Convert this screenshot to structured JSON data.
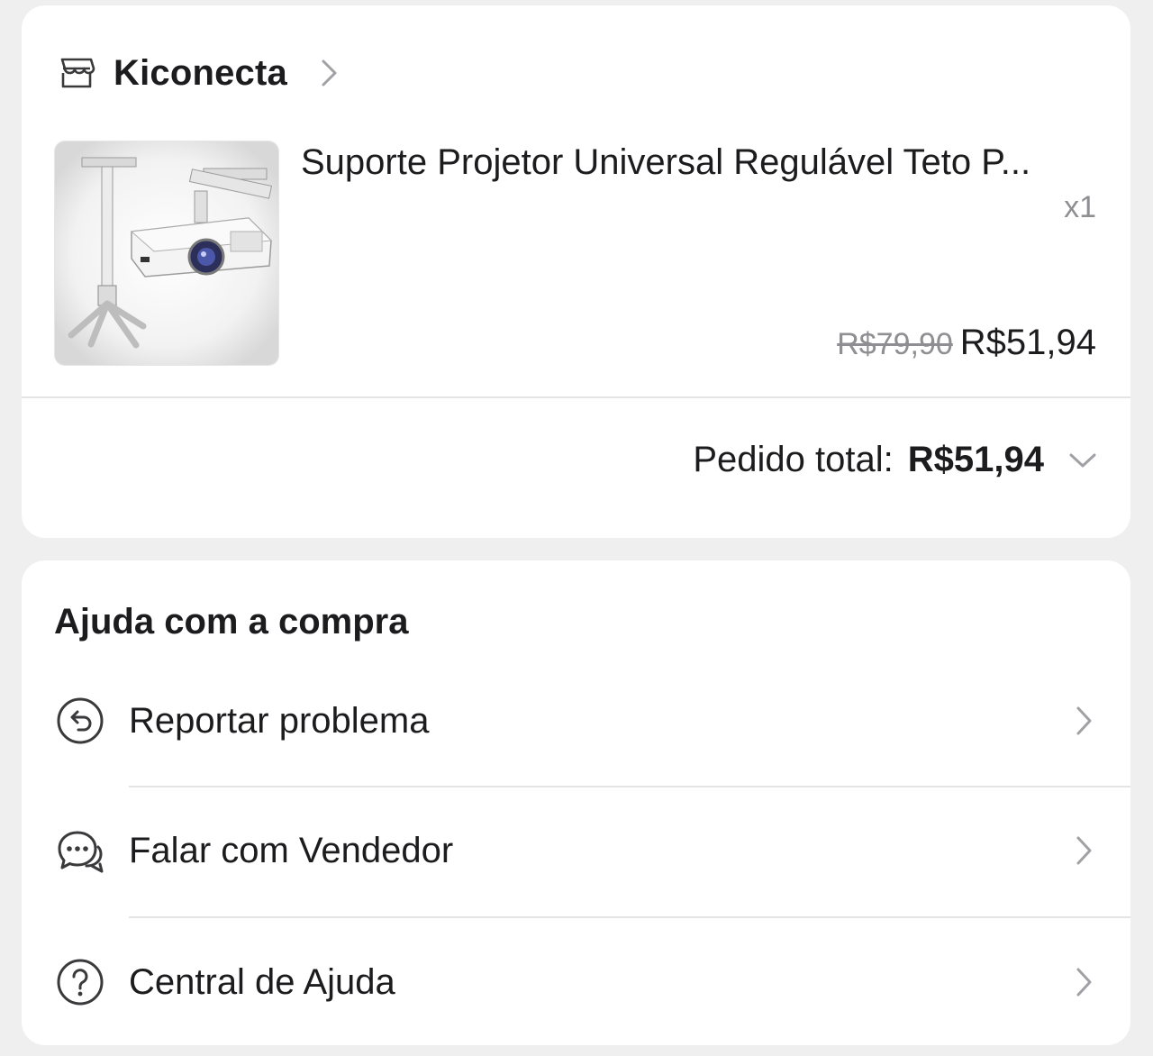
{
  "order": {
    "shop_name": "Kiconecta",
    "product": {
      "title": "Suporte Projetor Universal Regulável Teto P...",
      "quantity": "x1",
      "price_original": "R$79,90",
      "price_current": "R$51,94"
    },
    "total": {
      "label": "Pedido total:",
      "value": "R$51,94"
    }
  },
  "help": {
    "title": "Ajuda com a compra",
    "items": [
      {
        "label": "Reportar problema",
        "icon": "report-problem-icon"
      },
      {
        "label": "Falar com Vendedor",
        "icon": "chat-icon"
      },
      {
        "label": "Central de Ajuda",
        "icon": "help-circle-icon"
      }
    ]
  },
  "colors": {
    "background": "#efefef",
    "card": "#ffffff",
    "text": "#1c1c1e",
    "muted": "#8e8e93",
    "divider": "#e4e4e4"
  }
}
